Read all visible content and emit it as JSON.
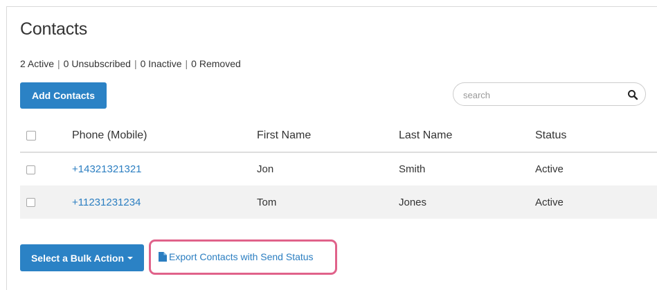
{
  "page": {
    "title": "Contacts"
  },
  "counts": {
    "active": "2 Active",
    "unsubscribed": "0 Unsubscribed",
    "inactive": "0 Inactive",
    "removed": "0 Removed",
    "separator": "|"
  },
  "toolbar": {
    "add_label": "Add Contacts",
    "search_placeholder": "search",
    "search_value": "",
    "search_icon": "search-icon"
  },
  "table": {
    "headers": [
      "Phone (Mobile)",
      "First Name",
      "Last Name",
      "Status"
    ],
    "rows": [
      {
        "phone": "+14321321321",
        "first": "Jon",
        "last": "Smith",
        "status": "Active"
      },
      {
        "phone": "+11231231234",
        "first": "Tom",
        "last": "Jones",
        "status": "Active"
      }
    ]
  },
  "footer": {
    "bulk_label": "Select a Bulk Action",
    "export_label": "Export Contacts with Send Status",
    "export_icon": "file-icon"
  },
  "colors": {
    "primary": "#2b82c5",
    "link": "#2b7ec1",
    "highlight": "#e0628a",
    "stripe": "#f2f2f2"
  }
}
